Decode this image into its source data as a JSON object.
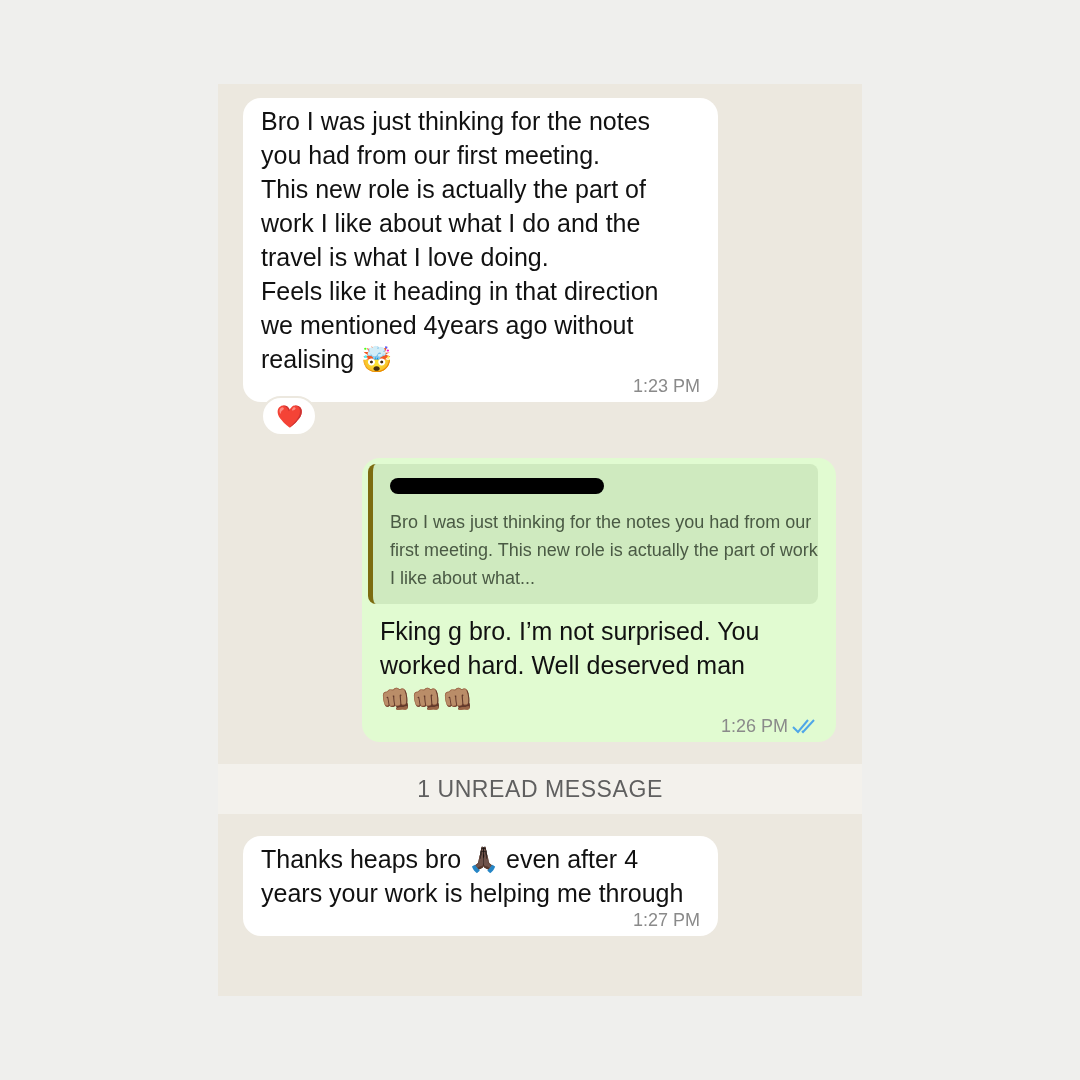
{
  "messages": [
    {
      "kind": "incoming",
      "text": "Bro I was just thinking for the notes you had from our first meeting.\nThis new role is actually the part of work I like about what I do and the travel is what I love doing.\nFeels like it heading in that direction we mentioned 4years ago without realising 🤯",
      "time": "1:23 PM",
      "reaction": "❤️"
    },
    {
      "kind": "outgoing",
      "quote": {
        "redacted": true,
        "text": "Bro I was just thinking for the notes you had from our first meeting. This new role is actually the part of work I like about what..."
      },
      "text": "Fking g bro. I’m not surprised. You worked hard. Well deserved man\n👊🏽👊🏽👊🏽",
      "time": "1:26 PM",
      "read": true
    },
    {
      "kind": "divider",
      "text": "1 UNREAD MESSAGE"
    },
    {
      "kind": "incoming",
      "text": "Thanks heaps bro 🙏🏿 even after 4 years your work is helping me through",
      "time": "1:27 PM"
    }
  ]
}
